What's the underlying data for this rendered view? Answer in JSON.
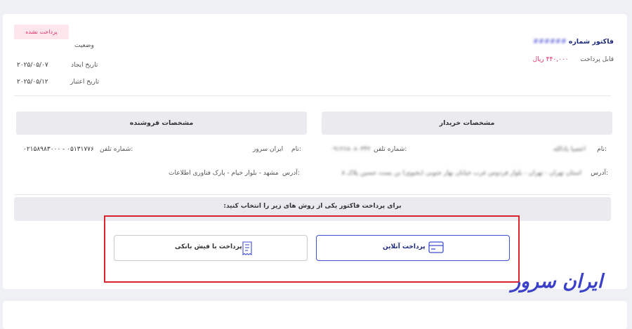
{
  "invoice": {
    "title": "فاکتور شماره",
    "number_masked": "######",
    "payable_label": "قابل پرداخت",
    "payable_amount": "۴۴۰,۰۰۰",
    "currency": "ریال",
    "status_label": "وضعیت",
    "status_value": "پرداخت نشده",
    "created_label": "تاریخ ایجاد",
    "created_value": "۲۰۲۵/۰۵/۰۷",
    "due_label": "تاریخ اعتبار",
    "due_value": "۲۰۲۵/۰۵/۱۲"
  },
  "buyer": {
    "heading": "مشخصات خریدار",
    "name_label": "نام:",
    "name_value": "اعضیا یادالله",
    "phone_label": "شماره تلفن:",
    "phone_value": "۰۹۱۲۶۸۰۸۰۳۴۲",
    "address_label": "آدرس:",
    "address_value": "استان تهران - تهران - بلوار فردوس غرب خیابان بهار جنوبی (بخیوی) بن بست حسین پلاک ۸"
  },
  "seller": {
    "heading": "مشخصات فروشنده",
    "name_label": "نام:",
    "name_value": "ایران سرور",
    "phone_label": "شماره تلفن:",
    "phone_value": "۰۵۱۳۱۷۷۶ - ۰۲۱۵۸۹۸۳۰۰۰",
    "address_label": "آدرس:",
    "address_value": "مشهد - بلوار خیام - پارک فناوری اطلاعات"
  },
  "payment": {
    "instruction": "برای پرداخت فاکتور یکی از روش های زیر را انتخاب کنید:",
    "online_label": "پرداخت آنلاین",
    "fish_label": "پرداخت با فیش بانکی"
  },
  "logo_text": "ایران سرور",
  "colors": {
    "accent": "#3f4fd6",
    "status": "#e0336a",
    "highlight": "#d9232f"
  }
}
